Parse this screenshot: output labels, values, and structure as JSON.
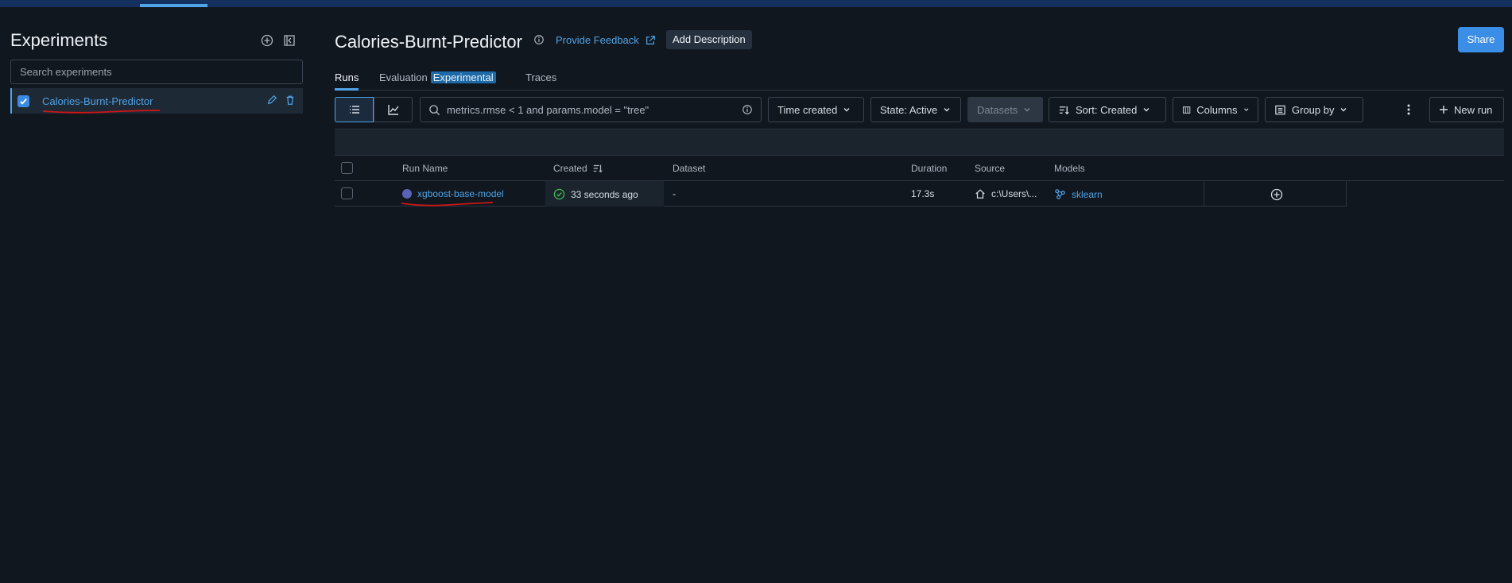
{
  "sidebar": {
    "title": "Experiments",
    "search_placeholder": "Search experiments",
    "experiments": [
      {
        "name": "Calories-Burnt-Predictor",
        "checked": true
      }
    ]
  },
  "header": {
    "title": "Calories-Burnt-Predictor",
    "feedback_label": "Provide Feedback",
    "add_description_label": "Add Description",
    "share_label": "Share"
  },
  "tabs": [
    {
      "label": "Runs",
      "active": true
    },
    {
      "label": "Evaluation",
      "badge": "Experimental"
    },
    {
      "label": "Traces"
    }
  ],
  "toolbar": {
    "search_placeholder": "metrics.rmse < 1 and params.model = \"tree\"",
    "time_created_label": "Time created",
    "state_label": "State: Active",
    "datasets_label": "Datasets",
    "sort_label": "Sort: Created",
    "columns_label": "Columns",
    "group_by_label": "Group by",
    "new_run_label": "New run"
  },
  "table": {
    "columns": [
      "Run Name",
      "Created",
      "Dataset",
      "Duration",
      "Source",
      "Models"
    ],
    "rows": [
      {
        "run_name": "xgboost-base-model",
        "created": "33 seconds ago",
        "dataset": "-",
        "duration": "17.3s",
        "source": "c:\\Users\\...",
        "model": "sklearn"
      }
    ]
  },
  "colors": {
    "accent": "#4fa3e6",
    "background": "#11171e",
    "success": "#3fb950",
    "run_dot": "#5b63b8"
  }
}
